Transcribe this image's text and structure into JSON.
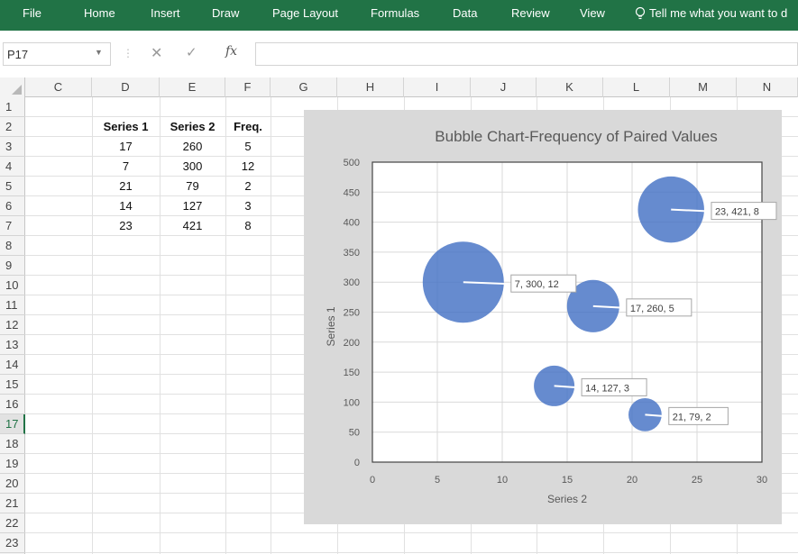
{
  "ribbon": {
    "tabs": [
      "File",
      "Home",
      "Insert",
      "Draw",
      "Page Layout",
      "Formulas",
      "Data",
      "Review",
      "View"
    ],
    "tell_me": "Tell me what you want to d"
  },
  "formula_bar": {
    "name_box": "P17",
    "formula": ""
  },
  "columns": [
    "C",
    "D",
    "E",
    "F",
    "G",
    "H",
    "I",
    "J",
    "K",
    "L",
    "M",
    "N"
  ],
  "rows": [
    "1",
    "2",
    "3",
    "4",
    "5",
    "6",
    "7",
    "8",
    "9",
    "10",
    "11",
    "12",
    "13",
    "14",
    "15",
    "16",
    "17",
    "18",
    "19",
    "20",
    "21",
    "22",
    "23"
  ],
  "selected_row": "17",
  "table": {
    "headers": [
      "Series 1",
      "Series 2",
      "Freq."
    ],
    "rows": [
      [
        "17",
        "260",
        "5"
      ],
      [
        "7",
        "300",
        "12"
      ],
      [
        "21",
        "79",
        "2"
      ],
      [
        "14",
        "127",
        "3"
      ],
      [
        "23",
        "421",
        "8"
      ]
    ]
  },
  "colors": {
    "ribbon": "#217346",
    "bubble": "#4472c4",
    "chart_bg": "#d9d9d9"
  },
  "chart_data": {
    "type": "scatter",
    "subtype": "bubble",
    "title": "Bubble Chart-Frequency of Paired Values",
    "xlabel": "Series 2",
    "ylabel": "Series 1",
    "xlim": [
      0,
      30
    ],
    "ylim": [
      0,
      500
    ],
    "xticks": [
      0,
      5,
      10,
      15,
      20,
      25,
      30
    ],
    "yticks": [
      0,
      50,
      100,
      150,
      200,
      250,
      300,
      350,
      400,
      450,
      500
    ],
    "grid": true,
    "points": [
      {
        "x": 17,
        "y": 260,
        "size": 5,
        "label": "17, 260, 5"
      },
      {
        "x": 7,
        "y": 300,
        "size": 12,
        "label": "7, 300, 12"
      },
      {
        "x": 21,
        "y": 79,
        "size": 2,
        "label": "21, 79, 2"
      },
      {
        "x": 14,
        "y": 127,
        "size": 3,
        "label": "14, 127, 3"
      },
      {
        "x": 23,
        "y": 421,
        "size": 8,
        "label": "23, 421, 8"
      }
    ]
  }
}
